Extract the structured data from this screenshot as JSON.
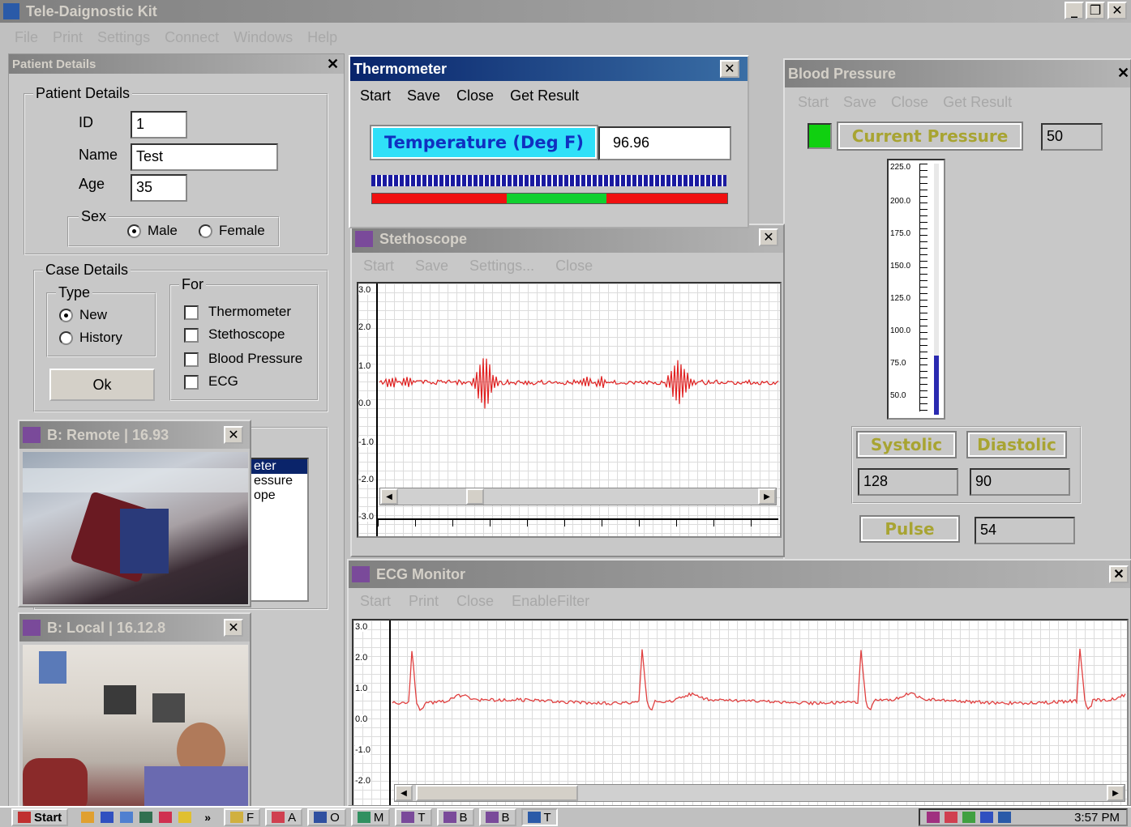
{
  "app": {
    "title": "Tele-Daignostic Kit",
    "menu": [
      "File",
      "Print",
      "Settings",
      "Connect",
      "Windows",
      "Help"
    ],
    "window_controls": [
      "_",
      "&#x1F5D7;",
      "X"
    ]
  },
  "patient_panel": {
    "title": "Patient Details",
    "group_title": "Patient Details",
    "id_label": "ID",
    "id_value": "1",
    "name_label": "Name",
    "name_value": "Test",
    "age_label": "Age",
    "age_value": "35",
    "sex_label": "Sex",
    "male_label": "Male",
    "female_label": "Female",
    "case_title": "Case Details",
    "type_title": "Type",
    "new_label": "New",
    "history_label": "History",
    "for_title": "For",
    "for_items": [
      "Thermometer",
      "Stethoscope",
      "Blood Pressure",
      "ECG"
    ],
    "ok_label": "Ok",
    "list_items": [
      "eter",
      "essure",
      "ope"
    ]
  },
  "thermometer": {
    "title": "Thermometer",
    "menu": [
      "Start",
      "Save",
      "Close",
      "Get Result"
    ],
    "label": "Temperature (Deg F)",
    "value": "96.96"
  },
  "blood_pressure": {
    "title": "Blood Pressure",
    "menu": [
      "Start",
      "Save",
      "Close",
      "Get Result"
    ],
    "current_label": "Current Pressure",
    "current_value": "50",
    "scale": [
      "225.0",
      "200.0",
      "175.0",
      "150.0",
      "125.0",
      "100.0",
      "75.0",
      "50.0"
    ],
    "level_fraction": 0.06,
    "systolic_label": "Systolic",
    "systolic_value": "128",
    "diastolic_label": "Diastolic",
    "diastolic_value": "90",
    "pulse_label": "Pulse",
    "pulse_value": "54"
  },
  "stethoscope": {
    "title": "Stethoscope",
    "menu": [
      "Start",
      "Save",
      "Settings...",
      "Close"
    ],
    "y_ticks": [
      "3.0",
      "2.0",
      "1.0",
      "0.0",
      "-1.0",
      "-2.0",
      "-3.0"
    ]
  },
  "ecg": {
    "title": "ECG Monitor",
    "menu": [
      "Start",
      "Print",
      "Close",
      "EnableFilter"
    ],
    "y_ticks": [
      "3.0",
      "2.0",
      "1.0",
      "0.0",
      "-1.0",
      "-2.0"
    ]
  },
  "video_remote": {
    "title": "B: Remote | 16.93"
  },
  "video_local": {
    "title": "B: Local | 16.12.8"
  },
  "taskbar": {
    "start_label": "Start",
    "buttons": [
      "F",
      "A",
      "O",
      "M",
      "T",
      "B",
      "B",
      "T"
    ],
    "clock": "3:57 PM"
  }
}
